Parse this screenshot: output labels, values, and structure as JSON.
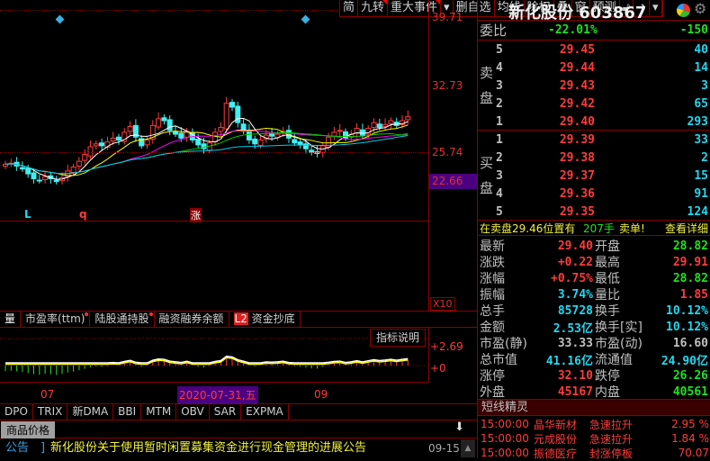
{
  "toolbar": {
    "items": [
      "简",
      "九转",
      "重大事件",
      "▾",
      "删自选",
      "均线",
      "除权",
      "叠",
      "窗",
      "预测"
    ]
  },
  "price_axis": {
    "top": "39.71",
    "mid": "32.73",
    "low": "25.74",
    "current": "22.66",
    "multiplier": "X10"
  },
  "chart_marks": {
    "l": "L",
    "q": "q",
    "zhang": "涨"
  },
  "chart_data": {
    "type": "candlestick",
    "price_range": [
      19.5,
      41.5
    ],
    "closes": [
      24.5,
      24.6,
      24.3,
      24.0,
      23.5,
      23.0,
      22.8,
      23.2,
      23.0,
      22.7,
      23.1,
      23.8,
      24.2,
      24.8,
      25.5,
      26.3,
      26.6,
      26.4,
      26.8,
      27.2,
      27.0,
      27.8,
      28.4,
      27.3,
      26.4,
      27.0,
      28.5,
      29.2,
      29.0,
      28.0,
      27.6,
      27.2,
      27.9,
      27.0,
      26.5,
      26.1,
      26.7,
      27.8,
      28.3,
      30.8,
      30.4,
      28.8,
      27.9,
      27.0,
      26.6,
      27.0,
      27.5,
      27.4,
      27.6,
      27.9,
      27.2,
      26.7,
      26.5,
      26.1,
      25.7,
      25.6,
      26.4,
      27.3,
      27.8,
      28.0,
      27.2,
      27.6,
      28.2,
      27.5,
      28.2,
      28.8,
      28.3,
      28.6,
      29.0,
      28.5,
      29.0,
      29.4
    ]
  },
  "tabs1": [
    "量",
    "市盈率(ttm)",
    "陆股通持股",
    "融资融券余额",
    "L2",
    "资金抄底"
  ],
  "indicator": {
    "help": "指标说明",
    "top": "+2.69",
    "zero": "+0"
  },
  "dates": {
    "m07": "07",
    "cursor": "2020-07-31,五",
    "m09": "09"
  },
  "tabs2": [
    "DPO",
    "TRIX",
    "新DMA",
    "BBI",
    "MTM",
    "OBV",
    "SAR",
    "EXPMA"
  ],
  "goods": {
    "label": "商品价格"
  },
  "notice": {
    "tag": "公告",
    "text": "新化股份关于使用暂时闲置募集资金进行现金管理的进展公告",
    "date": "09-15"
  },
  "quote": {
    "title": "新化股份 603867",
    "weibi_label": "委比",
    "weibi": "-22.01%",
    "weicha": "-150",
    "sell_label": "卖盘",
    "buy_label": "买盘",
    "sell": [
      [
        "5",
        "29.45",
        "40"
      ],
      [
        "4",
        "29.44",
        "14"
      ],
      [
        "3",
        "29.43",
        "3"
      ],
      [
        "2",
        "29.42",
        "65"
      ],
      [
        "1",
        "29.40",
        "293"
      ]
    ],
    "buy": [
      [
        "1",
        "29.39",
        "33"
      ],
      [
        "2",
        "29.38",
        "2"
      ],
      [
        "3",
        "29.37",
        "15"
      ],
      [
        "4",
        "29.36",
        "91"
      ],
      [
        "5",
        "29.35",
        "124"
      ]
    ],
    "info": {
      "a": "在卖盘29.46位置有",
      "b": "207手",
      "c": "卖单!",
      "d": "查看详细"
    },
    "stats": [
      [
        "最新",
        "29.40",
        "red",
        "开盘",
        "28.82",
        "green"
      ],
      [
        "涨跌",
        "+0.22",
        "red",
        "最高",
        "29.91",
        "red"
      ],
      [
        "涨幅",
        "+0.75%",
        "red",
        "最低",
        "28.82",
        "green"
      ],
      [
        "振幅",
        "3.74%",
        "cyan",
        "量比",
        "1.85",
        "red"
      ],
      [
        "总手",
        "85728",
        "cyan",
        "换手",
        "10.12%",
        "cyan"
      ],
      [
        "金额",
        "2.53亿",
        "cyan",
        "换手[实]",
        "10.12%",
        "cyan"
      ],
      [
        "市盈(静)",
        "33.33",
        "gray",
        "市盈(动)",
        "16.60",
        "gray"
      ],
      [
        "总市值",
        "41.16亿",
        "cyan",
        "流通值",
        "24.90亿",
        "cyan"
      ],
      [
        "涨停",
        "32.10",
        "red",
        "跌停",
        "26.26",
        "green"
      ],
      [
        "外盘",
        "45167",
        "red",
        "内盘",
        "40561",
        "green"
      ]
    ]
  },
  "sprite": {
    "title": "短线精灵",
    "rows": [
      [
        "15:00:00",
        "晶华新材",
        "急速拉升",
        "2.95 %"
      ],
      [
        "15:00:00",
        "元成股份",
        "急速拉升",
        "1.84 %"
      ],
      [
        "15:00:00",
        "振德医疗",
        "封涨停板",
        "70.07"
      ]
    ]
  }
}
